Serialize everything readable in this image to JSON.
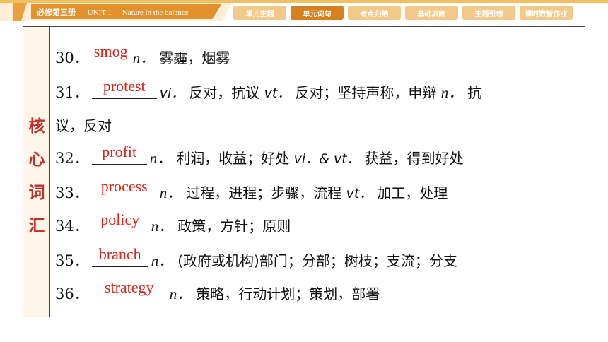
{
  "header": {
    "book": "必修第三册",
    "unit": "UNIT 1",
    "unit_title": "Nature in the balance"
  },
  "tabs": [
    {
      "label": "单元主题",
      "active": false
    },
    {
      "label": "单元词句",
      "active": true
    },
    {
      "label": "考点归纳",
      "active": false
    },
    {
      "label": "基础巩固",
      "active": false
    },
    {
      "label": "主题引领",
      "active": false
    },
    {
      "label": "课时数智作业",
      "active": false
    }
  ],
  "side_label": "核心词汇",
  "entries": [
    {
      "num": "30．",
      "answer": "smog",
      "parts": [
        {
          "pos": "n．",
          "def": "雾霾，烟雾"
        }
      ]
    },
    {
      "num": "31．",
      "answer": "protest",
      "parts": [
        {
          "pos": "vi．",
          "def": "反对，抗议 "
        },
        {
          "pos": "vt．",
          "def": "反对；坚持声称，申辩 "
        },
        {
          "pos": "n．",
          "def": "抗"
        }
      ],
      "continuation": "议，反对"
    },
    {
      "num": "32．",
      "answer": "profit",
      "parts": [
        {
          "pos": "n．",
          "def": "利润，收益；好处 "
        },
        {
          "pos": "vi．& vt．",
          "def": "获益，得到好处"
        }
      ]
    },
    {
      "num": "33．",
      "answer": "process",
      "parts": [
        {
          "pos": "n．",
          "def": "过程，进程；步骤，流程 "
        },
        {
          "pos": "vt．",
          "def": "加工，处理"
        }
      ]
    },
    {
      "num": "34．",
      "answer": "policy",
      "parts": [
        {
          "pos": "n．",
          "def": "政策，方针；原则"
        }
      ]
    },
    {
      "num": "35．",
      "answer": "branch",
      "parts": [
        {
          "pos": "n．",
          "def": "(政府或机构)部门；分部；树枝；支流；分支"
        }
      ]
    },
    {
      "num": "36．",
      "answer": "strategy",
      "parts": [
        {
          "pos": "n．",
          "def": "策略，行动计划；策划，部署"
        }
      ]
    }
  ]
}
